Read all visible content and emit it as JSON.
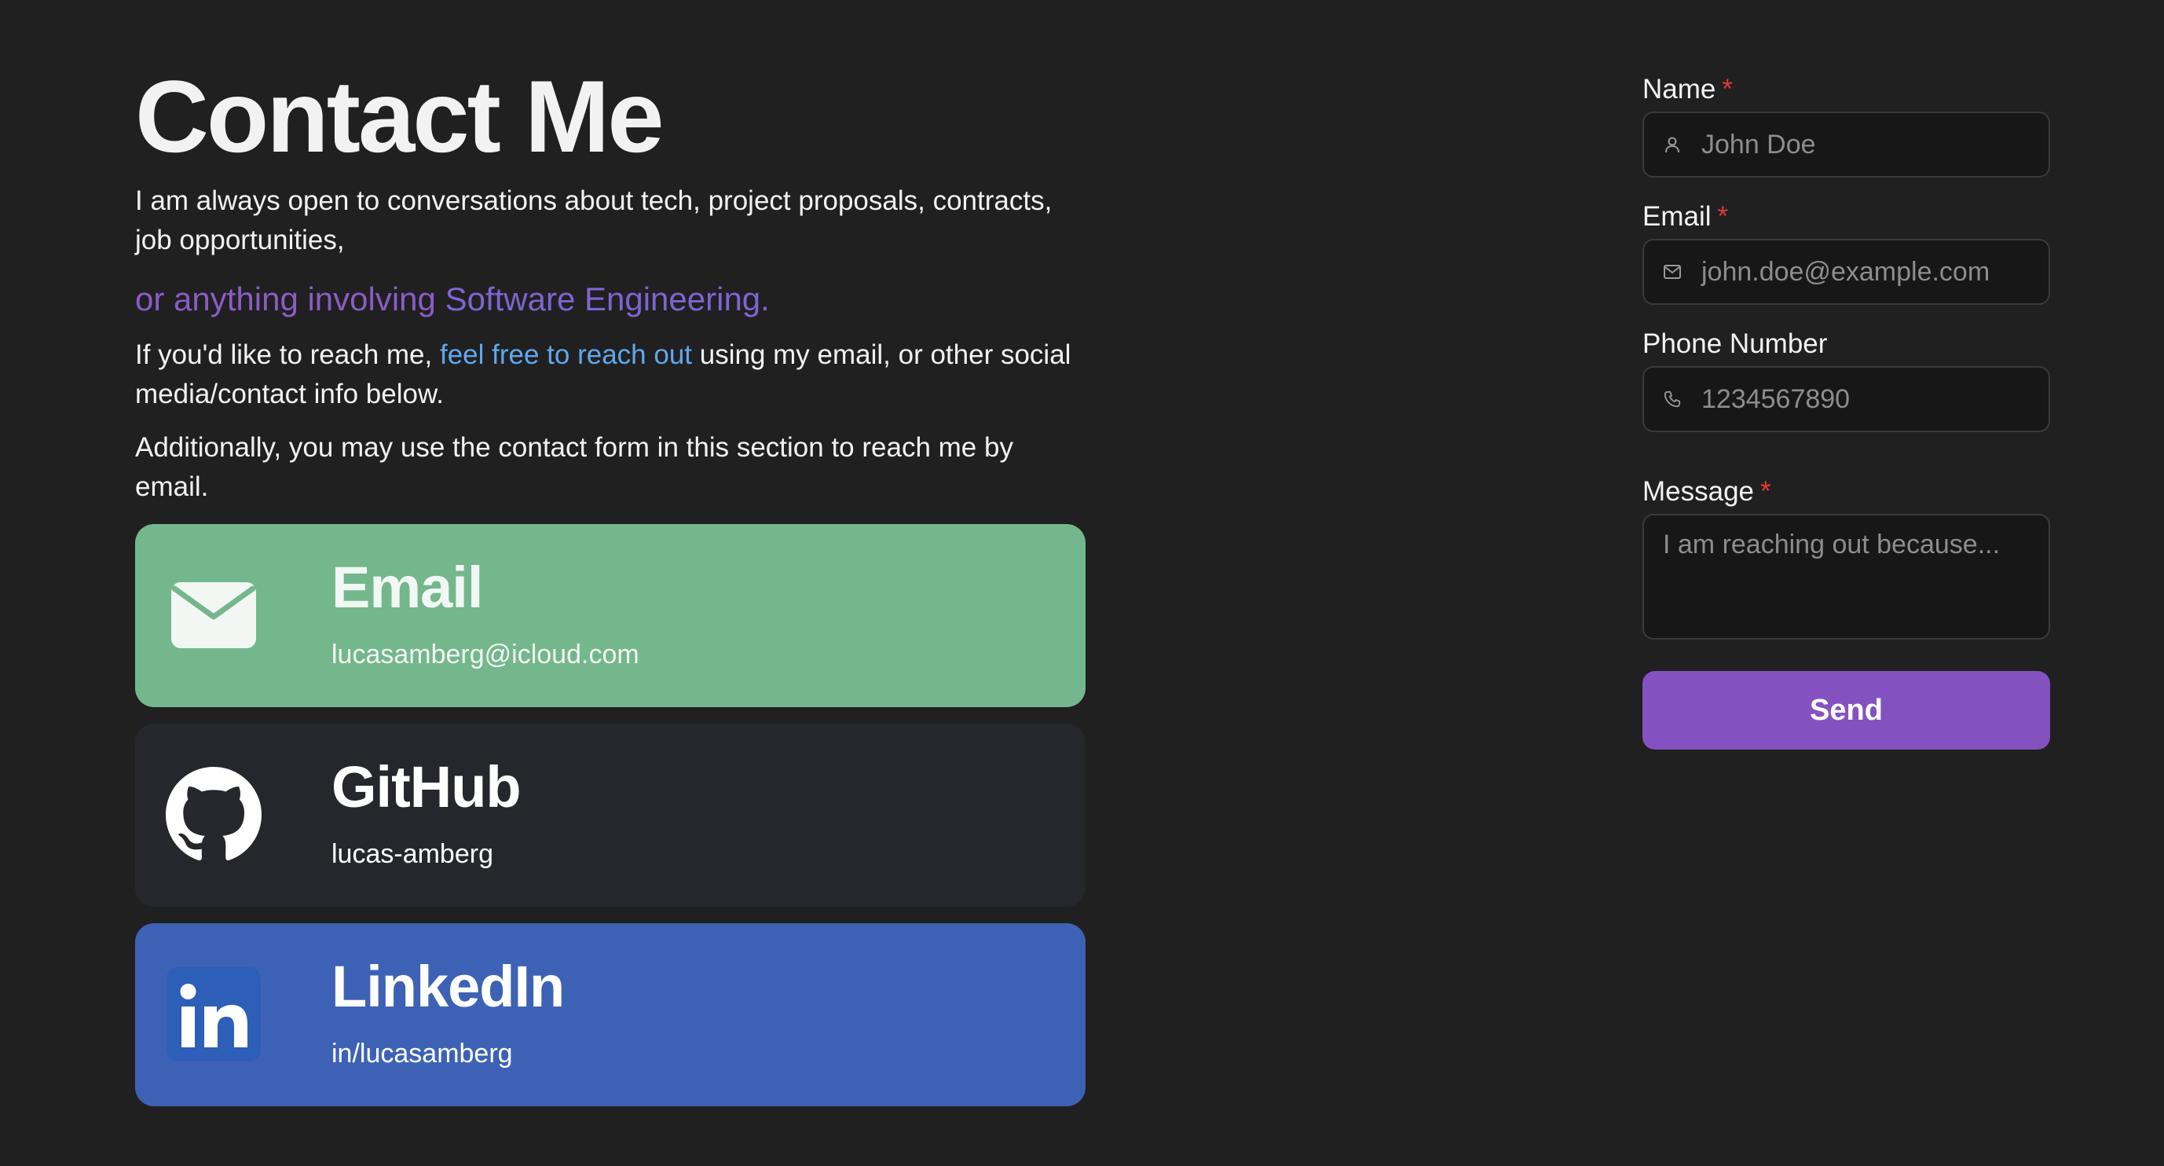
{
  "heading": {
    "title": "Contact Me",
    "intro": "I am always open to conversations about tech, project proposals, contracts, job opportunities,",
    "accent_a": "or anything involving ",
    "accent_b": "Software Engineering.",
    "reach_pre": "If you'd like to reach me, ",
    "reach_link": "feel free to reach out",
    "reach_post": " using my email, or other social media/contact info below.",
    "form_note": "Additionally, you may use the contact form in this section to reach me by email."
  },
  "cards": [
    {
      "title": "Email",
      "value": "lucasamberg@icloud.com",
      "icon": "mail-icon",
      "color": "#74b78d"
    },
    {
      "title": "GitHub",
      "value": "lucas-amberg",
      "icon": "github-icon",
      "color": "#25272c"
    },
    {
      "title": "LinkedIn",
      "value": "in/lucasamberg",
      "icon": "linkedin-icon",
      "color": "#3d62b5"
    }
  ],
  "form": {
    "name_label": "Name",
    "name_placeholder": "John Doe",
    "email_label": "Email",
    "email_placeholder": "john.doe@example.com",
    "phone_label": "Phone Number",
    "phone_placeholder": "1234567890",
    "message_label": "Message",
    "message_placeholder": "I am reaching out because...",
    "required_mark": "*",
    "send_label": "Send"
  },
  "colors": {
    "background": "#202020",
    "accent_purple": "#8452c0",
    "link_blue": "#5fa8ee",
    "required_red": "#e23b3b"
  }
}
